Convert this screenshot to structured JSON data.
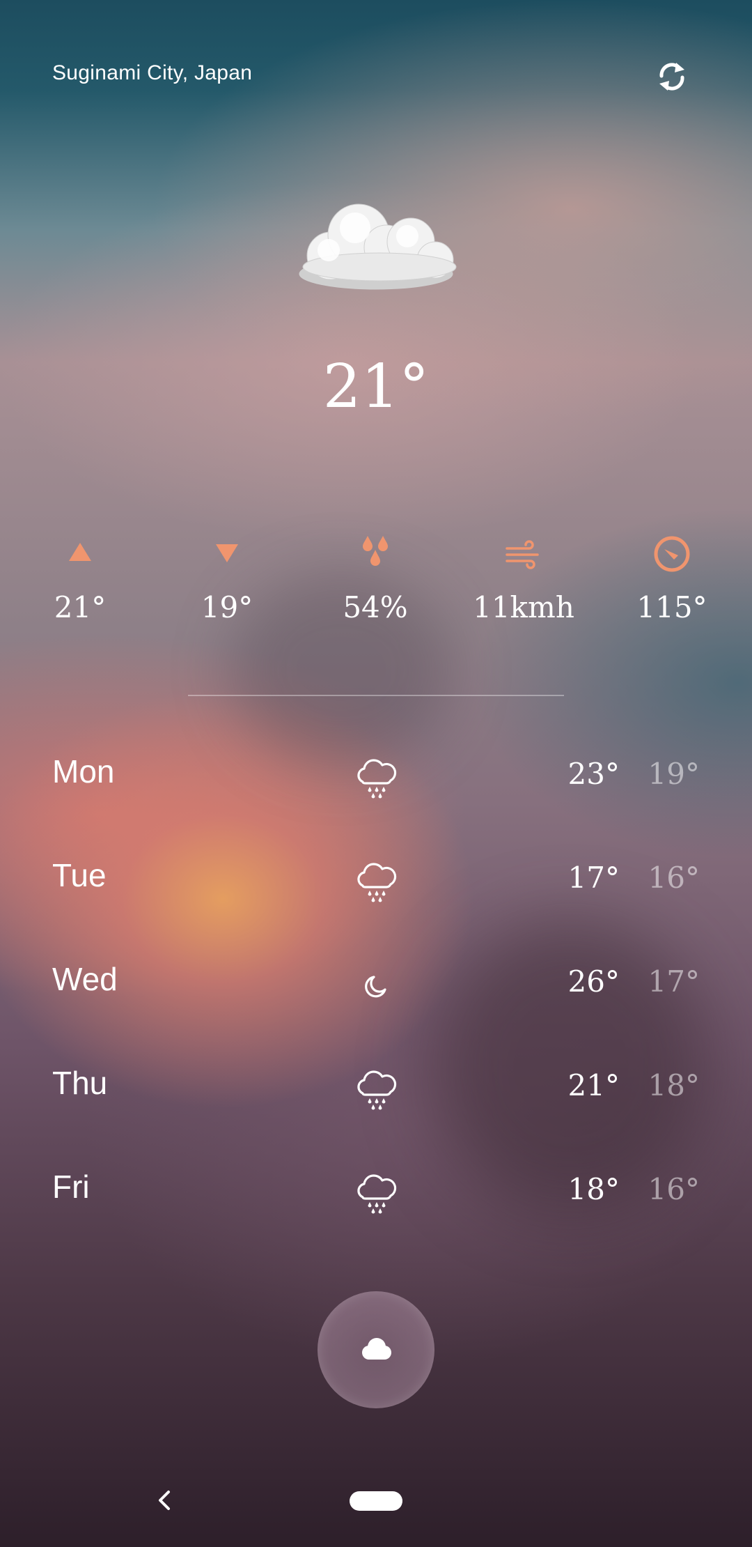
{
  "header": {
    "location": "Suginami City, Japan",
    "refresh_icon": "refresh-icon"
  },
  "current": {
    "condition_icon": "cloud-icon",
    "temperature": "21°"
  },
  "stats": {
    "accent_color": "#f0956e",
    "items": [
      {
        "icon": "triangle-up-icon",
        "value": "21°"
      },
      {
        "icon": "triangle-down-icon",
        "value": "19°"
      },
      {
        "icon": "droplets-icon",
        "value": "54%"
      },
      {
        "icon": "wind-icon",
        "value": "11kmh"
      },
      {
        "icon": "compass-icon",
        "value": "115°"
      }
    ]
  },
  "forecast": [
    {
      "day": "Mon",
      "icon": "rain-cloud-icon",
      "high": "23°",
      "low": "19°"
    },
    {
      "day": "Tue",
      "icon": "rain-cloud-icon",
      "high": "17°",
      "low": "16°"
    },
    {
      "day": "Wed",
      "icon": "moon-icon",
      "high": "26°",
      "low": "17°"
    },
    {
      "day": "Thu",
      "icon": "rain-cloud-icon",
      "high": "21°",
      "low": "18°"
    },
    {
      "day": "Fri",
      "icon": "rain-cloud-icon",
      "high": "18°",
      "low": "16°"
    }
  ],
  "fab": {
    "icon": "cloud-icon"
  },
  "navbar": {
    "back_icon": "back-chevron-icon",
    "home_icon": "home-pill"
  }
}
